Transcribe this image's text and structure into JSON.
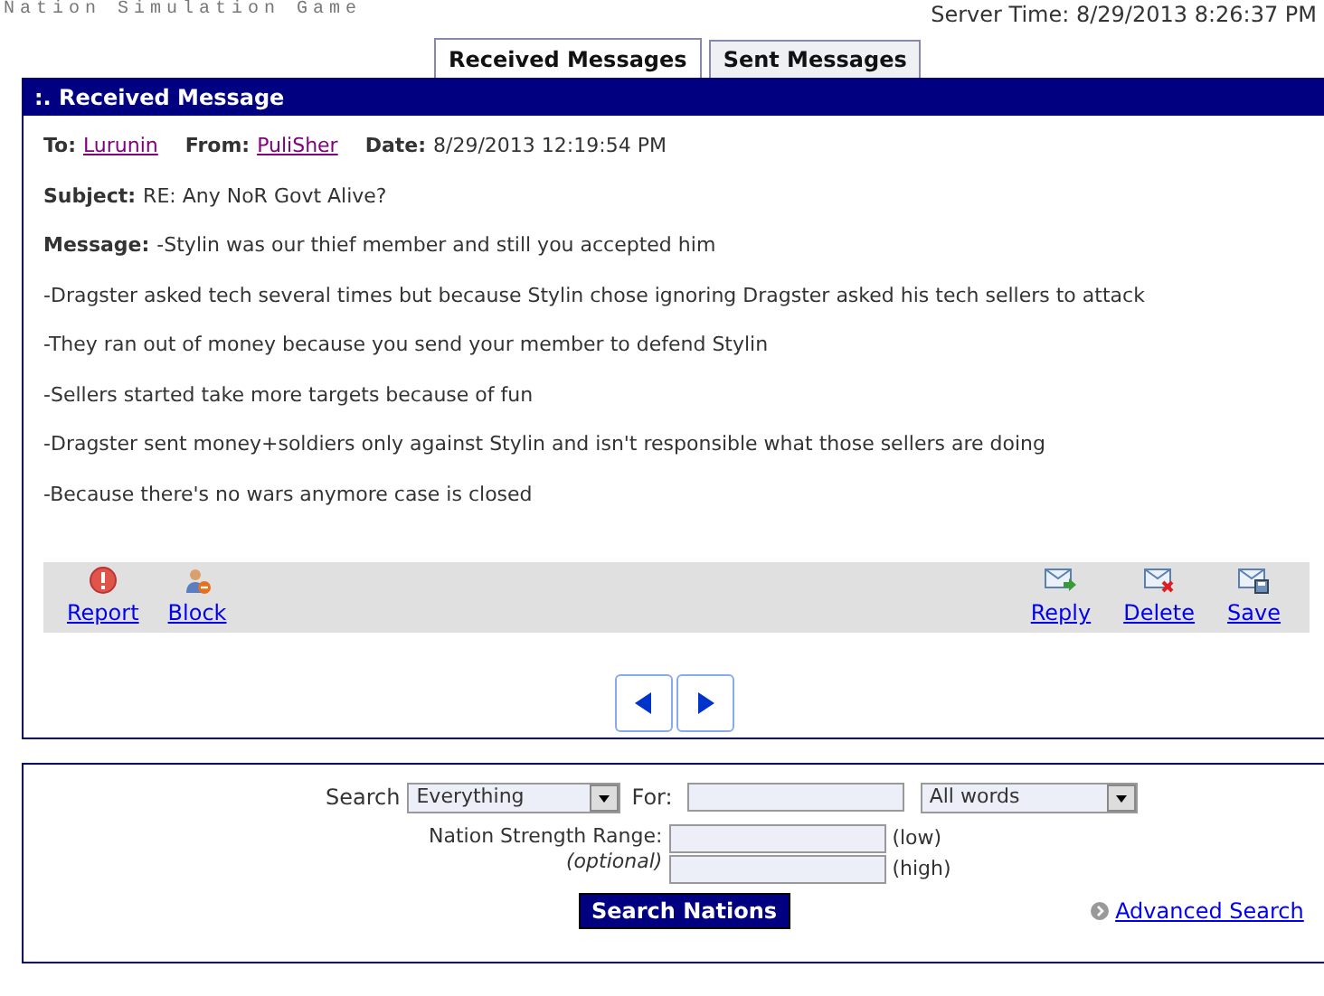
{
  "site_title": "Nation Simulation Game",
  "server_time": "Server Time: 8/29/2013 8:26:37 PM",
  "tabs": [
    {
      "label": "Received Messages",
      "selected": true
    },
    {
      "label": "Sent Messages",
      "selected": false
    }
  ],
  "message_panel": {
    "title": ":. Received Message",
    "to_label": "To:",
    "to": "Lurunin",
    "from_label": "From:",
    "from": "PuliSher",
    "date_label": "Date:",
    "date": "8/29/2013 12:19:54 PM",
    "subject_label": "Subject:",
    "subject": "RE: Any NoR Govt Alive?",
    "message_label": "Message:",
    "lines": [
      "-Stylin was our thief member and still you accepted him",
      "-Dragster asked tech several times but because Stylin chose ignoring Dragster asked his tech sellers to attack",
      "-They ran out of money because you send your member to defend Stylin",
      "-Sellers started take more targets because of fun",
      "-Dragster sent money+soldiers only against Stylin and isn't responsible what those sellers are doing",
      "-Because there's no wars anymore case is closed"
    ],
    "left_actions": [
      {
        "kind": "report",
        "label": "Report"
      },
      {
        "kind": "block",
        "label": "Block"
      }
    ],
    "right_actions": [
      {
        "kind": "reply",
        "label": "Reply"
      },
      {
        "kind": "delete",
        "label": "Delete"
      },
      {
        "kind": "save",
        "label": "Save"
      }
    ]
  },
  "search": {
    "label": "Search",
    "scope": "Everything",
    "for_label": "For:",
    "match": "All words",
    "range_label": "Nation Strength Range:",
    "optional": "(optional)",
    "low": "(low)",
    "high": "(high)",
    "button": "Search Nations",
    "advanced": "Advanced Search"
  }
}
